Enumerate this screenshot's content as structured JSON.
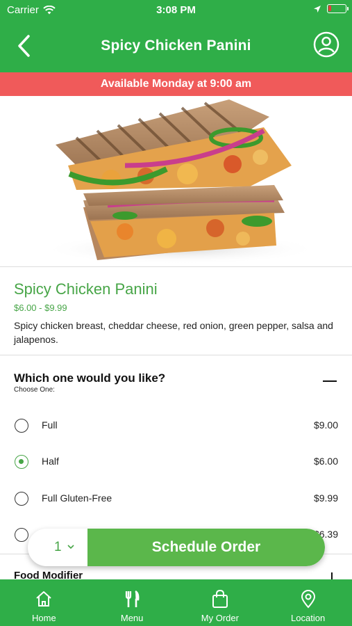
{
  "status_bar": {
    "carrier": "Carrier",
    "time": "3:08 PM"
  },
  "header": {
    "title": "Spicy Chicken Panini"
  },
  "availability": "Available Monday at 9:00 am",
  "product": {
    "name": "Spicy Chicken Panini",
    "price_range": "$6.00 - $9.99",
    "description": "Spicy chicken breast, cheddar cheese, red onion, green pepper, salsa and jalapenos."
  },
  "options_group": {
    "question": "Which one would you like?",
    "instruction": "Choose One:",
    "options": [
      {
        "label": "Full",
        "price": "$9.00",
        "selected": false
      },
      {
        "label": "Half",
        "price": "$6.00",
        "selected": true
      },
      {
        "label": "Full Gluten-Free",
        "price": "$9.99",
        "selected": false
      },
      {
        "label": "",
        "price": "$6.39",
        "selected": false
      }
    ]
  },
  "modifier_group": {
    "title": "Food Modifier"
  },
  "order_bar": {
    "quantity": "1",
    "button_label": "Schedule Order"
  },
  "tabs": [
    {
      "label": "Home",
      "icon": "home-icon"
    },
    {
      "label": "Menu",
      "icon": "fork-knife-icon"
    },
    {
      "label": "My Order",
      "icon": "shopping-bag-icon"
    },
    {
      "label": "Location",
      "icon": "location-pin-icon"
    }
  ],
  "colors": {
    "brand_green": "#2fae48",
    "accent_green": "#47a547",
    "button_green": "#5bb74b",
    "alert_red": "#f05a5a"
  }
}
